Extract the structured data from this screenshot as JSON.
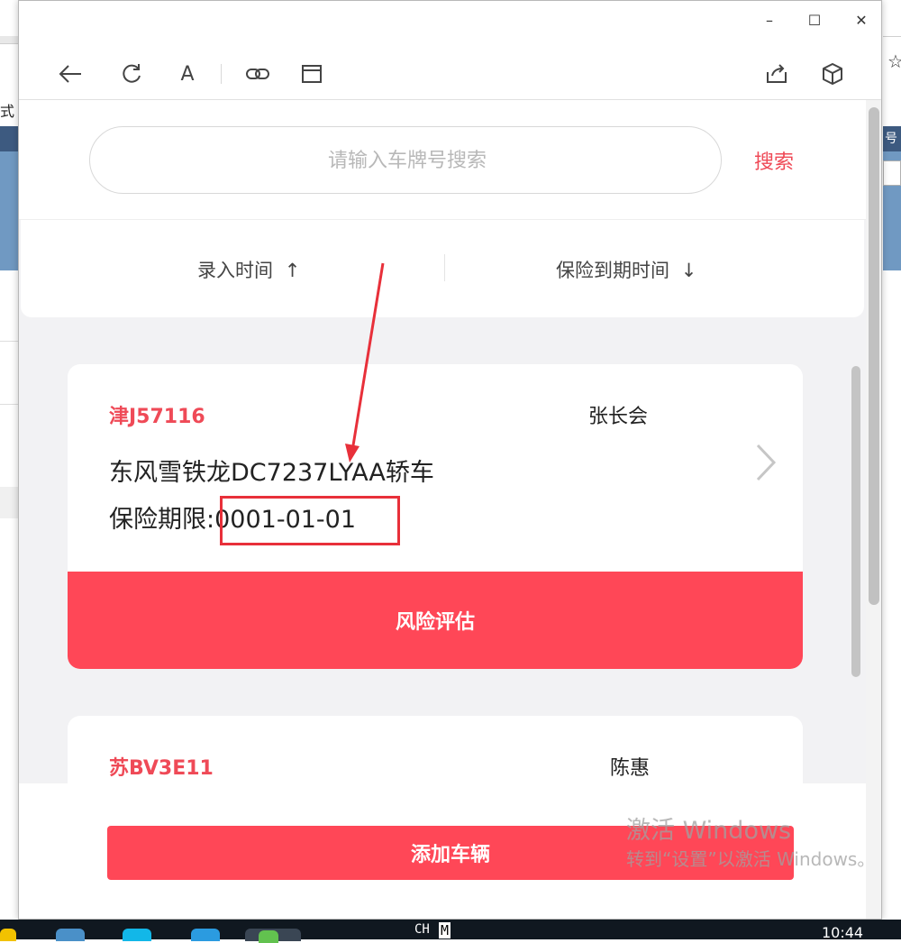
{
  "background": {
    "left_text": "式",
    "right_band_text": "号"
  },
  "window": {
    "controls": {
      "minimize": "–",
      "maximize": "☐",
      "close": "✕"
    }
  },
  "toolbar": {
    "font_label": "A"
  },
  "search": {
    "placeholder": "请输入车牌号搜索",
    "button_label": "搜索"
  },
  "sort": {
    "entry_time_label": "录入时间",
    "entry_time_arrow": "↑",
    "expiry_label": "保险到期时间",
    "expiry_arrow": "↓"
  },
  "vehicles": [
    {
      "plate": "津J57116",
      "owner": "张长会",
      "model": "东风雪铁龙DC7237LYAA轿车",
      "expiry_label": "保险期限:",
      "expiry_value": "0001-01-01",
      "action_label": "风险评估"
    },
    {
      "plate": "苏BV3E11",
      "owner": "陈惠"
    }
  ],
  "footer": {
    "add_button_label": "添加车辆"
  },
  "watermark": {
    "line1": "激活 Windows",
    "line2": "转到“设置”以激活 Windows。"
  },
  "taskbar": {
    "lang": "CH",
    "ime": "M",
    "time": "10:44"
  },
  "colors": {
    "accent": "#ff4757",
    "plate_text": "#ef4a57",
    "annotation": "#e8303a"
  }
}
